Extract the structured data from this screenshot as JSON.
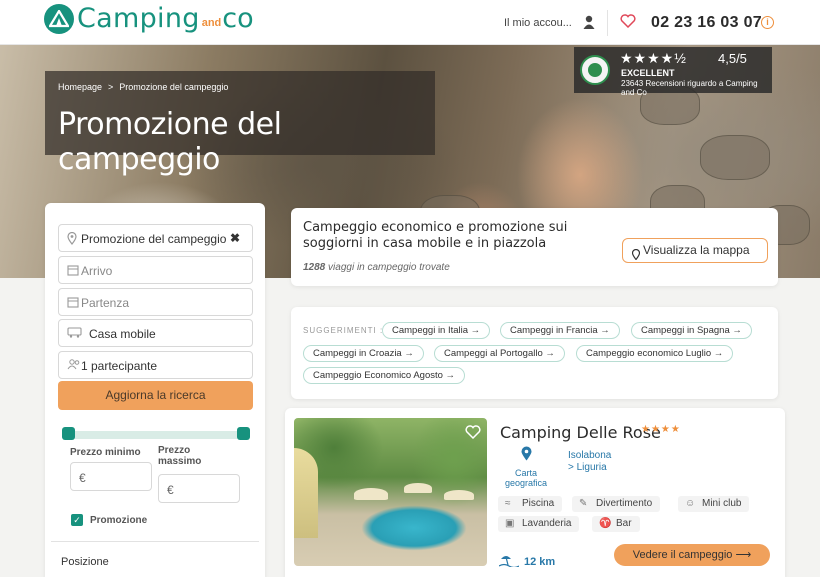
{
  "header": {
    "logo_main": "Camping",
    "logo_small": "and",
    "logo_end": "co",
    "account_label": "Il mio accou...",
    "phone": "02 23 16 03 07"
  },
  "hero": {
    "breadcrumb": [
      "Homepage",
      "Promozione del campeggio"
    ],
    "breadcrumb_sep": ">",
    "title": "Promozione del campeggio",
    "review": {
      "stars": "★★★★½",
      "score": "4,5/5",
      "rating_label": "EXCELLENT",
      "text": "23643 Recensioni riguardo a Camping and Co"
    }
  },
  "search": {
    "destination": "Promozione del campeggio",
    "clear_icon": "✖",
    "arrival_placeholder": "Arrivo",
    "departure_placeholder": "Partenza",
    "accommodation": "Casa mobile",
    "participants": "1 partecipante",
    "update_button": "Aggiorna la ricerca",
    "price_min_label": "Prezzo minimo",
    "price_max_label": "Prezzo massimo",
    "currency": "€",
    "promo_label": "Promozione",
    "promo_checked": true,
    "position_label": "Posizione"
  },
  "results": {
    "title": "Campeggio economico e promozione sui soggiorni in casa mobile e in piazzola",
    "count": "1288",
    "count_suffix": "viaggi in campeggio trovate",
    "map_button": "Visualizza la mappa"
  },
  "suggestions": {
    "label": "SUGGERIMENTI :",
    "chips": [
      "Campeggi in Italia →",
      "Campeggi in Francia →",
      "Campeggi in Spagna →",
      "Campeggi in Croazia →",
      "Campeggi al Portogallo →",
      "Campeggio economico Luglio →",
      "Campeggio Economico Agosto →"
    ]
  },
  "listing": {
    "name": "Camping Delle Rose",
    "stars": "★★★★",
    "map_label": "Carta geografica",
    "town": "Isolabona",
    "region": "> Liguria",
    "amenities": [
      "Piscina",
      "Divertimento",
      "Mini club",
      "Lavanderia",
      "Bar"
    ],
    "distance": "12 km",
    "cta": "Vedere il campeggio ⟶"
  },
  "colors": {
    "brand": "#17927e",
    "accent": "#f0a15c",
    "link": "#2878a8"
  }
}
